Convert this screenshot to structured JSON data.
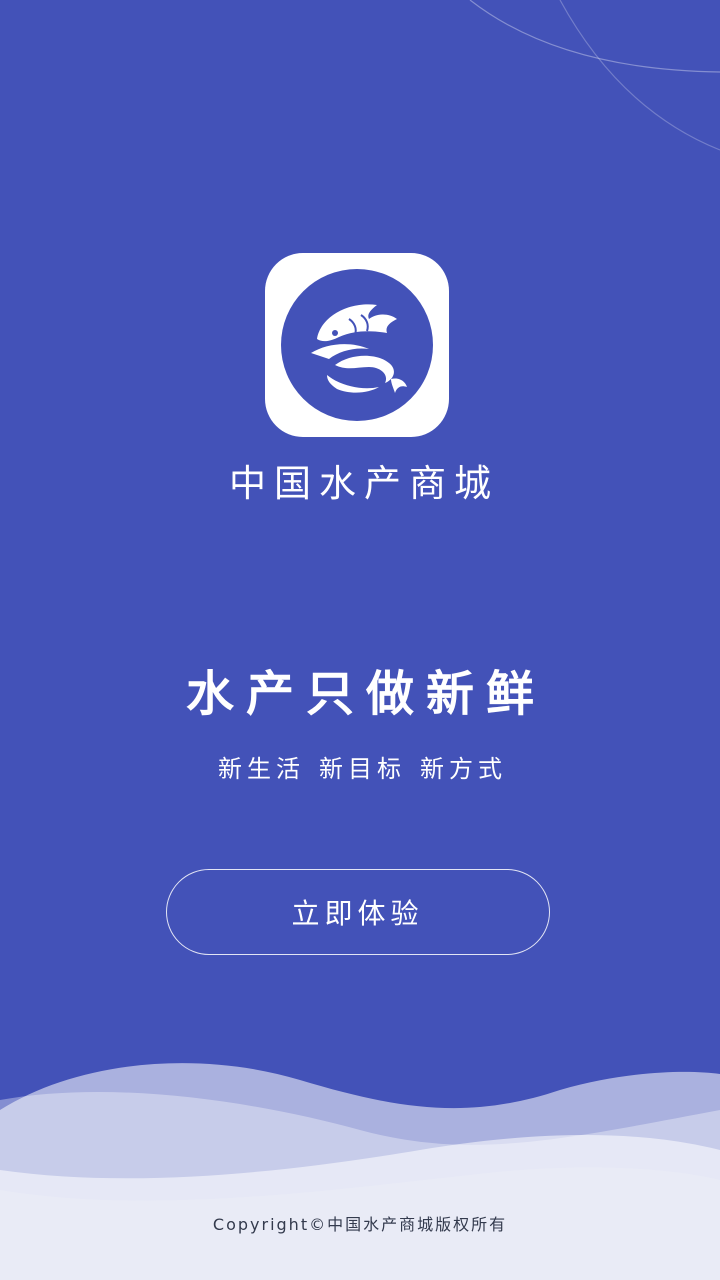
{
  "colors": {
    "background": "#4352b8",
    "logo_tile": "#ffffff",
    "text": "#ffffff",
    "copyright_text": "#333a4d"
  },
  "logo": {
    "icon": "fish-logo-icon"
  },
  "app_name": "中国水产商城",
  "slogan": "水产只做新鲜",
  "subline": [
    "新生活",
    "新目标",
    "新方式"
  ],
  "cta_label": "立即体验",
  "copyright": "Copyright©中国水产商城版权所有"
}
